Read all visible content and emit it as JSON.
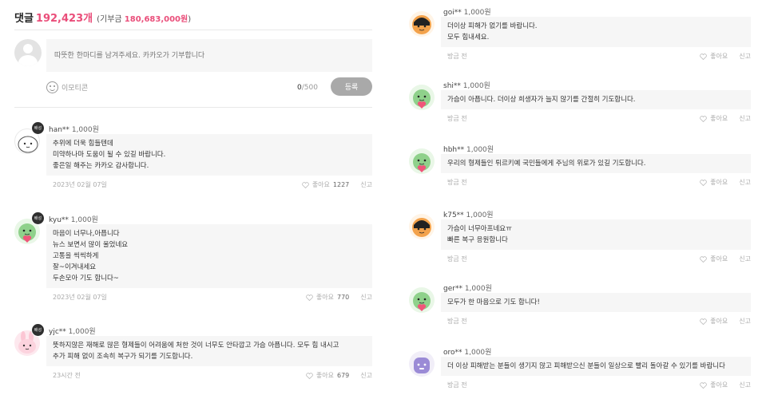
{
  "header": {
    "label": "댓글",
    "count": "192,423개",
    "donation_prefix": "(기부금",
    "donation_amount": "180,683,000원",
    "donation_suffix": ")"
  },
  "write": {
    "placeholder": "따뜻한 한마디를 남겨주세요. 카카오가 기부합니다",
    "emoticon_label": "이모티콘",
    "count_current": "0",
    "count_max": "/500",
    "submit_label": "등록"
  },
  "badge_text": "배성",
  "left_comments": [
    {
      "name": "han**",
      "amount": "1,000원",
      "avatar": "white-character",
      "lines": [
        "추위에 더욱 힘들텐데",
        "미약하나마 도움이 될 수 있길 바랍니다.",
        "좋은일 해주는 카카오 감사합니다."
      ],
      "date": "2023년 02월 07일",
      "like_label": "좋아요",
      "like_count": "1227",
      "report": "신고"
    },
    {
      "name": "kyu**",
      "amount": "1,000원",
      "avatar": "green-character",
      "lines": [
        "마음이 너무나,아픕니다",
        "뉴스 보면서 많이 울었네요",
        "고통을 씩씩하게",
        "잘~이겨내세요",
        "두손모아 기도 합니다~"
      ],
      "date": "2023년 02월 07일",
      "like_label": "좋아요",
      "like_count": "770",
      "report": "신고"
    },
    {
      "name": "yjc**",
      "amount": "1,000원",
      "avatar": "pink-rabbit",
      "lines": [
        "뜻하지않은 재해로 많은 형제들이 어려움에 처한 것이 너무도 안타깝고 가슴 아픕니다. 모두 힘 내시고",
        "추가 피해 없이 조속히 복구가 되기를 기도합니다."
      ],
      "date": "23시간 전",
      "like_label": "좋아요",
      "like_count": "679",
      "report": "신고"
    }
  ],
  "right_comments": [
    {
      "name": "goi**",
      "amount": "1,000원",
      "avatar": "orange-character",
      "lines": [
        "더이상 피해가 없기를 바랍니다.",
        "모두 힘내세요."
      ],
      "date": "방금 전",
      "like_label": "좋아요",
      "report": "신고"
    },
    {
      "name": "shi**",
      "amount": "1,000원",
      "avatar": "green-character",
      "lines": [
        "가슴이 아픕니다. 더이상 희생자가 늘지 않기를 간절히 기도합니다."
      ],
      "date": "방금 전",
      "like_label": "좋아요",
      "report": "신고"
    },
    {
      "name": "hbh**",
      "amount": "1,000원",
      "avatar": "green-character",
      "lines": [
        "우리의 형제들인 튀르키예 국민들에게 주님의 위로가 있길 기도합니다."
      ],
      "date": "방금 전",
      "like_label": "좋아요",
      "report": "신고"
    },
    {
      "name": "k75**",
      "amount": "1,000원",
      "avatar": "orange-character",
      "lines": [
        "가슴이 너무아프네요ㅠ",
        "빠른 복구 응원합니다"
      ],
      "date": "방금 전",
      "like_label": "좋아요",
      "report": "신고"
    },
    {
      "name": "ger**",
      "amount": "1,000원",
      "avatar": "green-character",
      "lines": [
        "모두가 한 마음으로 기도 합니다!"
      ],
      "date": "방금 전",
      "like_label": "좋아요",
      "report": "신고"
    },
    {
      "name": "oro**",
      "amount": "1,000원",
      "avatar": "purple-character",
      "lines": [
        "더 이상 피해받는 분들이 생기지 않고 피해받으신 분들이 일상으로 빨리 돌아갈 수 있기를 바랍니다"
      ],
      "date": "방금 전",
      "like_label": "좋아요",
      "report": "신고"
    }
  ]
}
